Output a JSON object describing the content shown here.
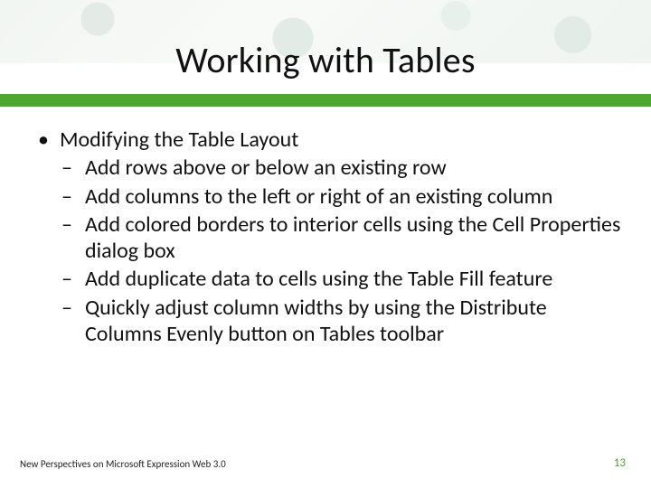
{
  "title": "Working with Tables",
  "bullets": {
    "main": "Modifying the Table Layout",
    "subs": [
      "Add rows above or below an existing row",
      "Add columns to the left or right of an existing column",
      "Add colored borders to interior cells using the Cell Properties dialog box",
      "Add duplicate data to cells using the Table Fill feature",
      "Quickly adjust column widths by using the Distribute Columns Evenly button on Tables toolbar"
    ]
  },
  "footer": {
    "left": "New Perspectives on Microsoft Expression Web 3.0",
    "right": "13"
  },
  "colors": {
    "accent": "#4ea72e"
  }
}
